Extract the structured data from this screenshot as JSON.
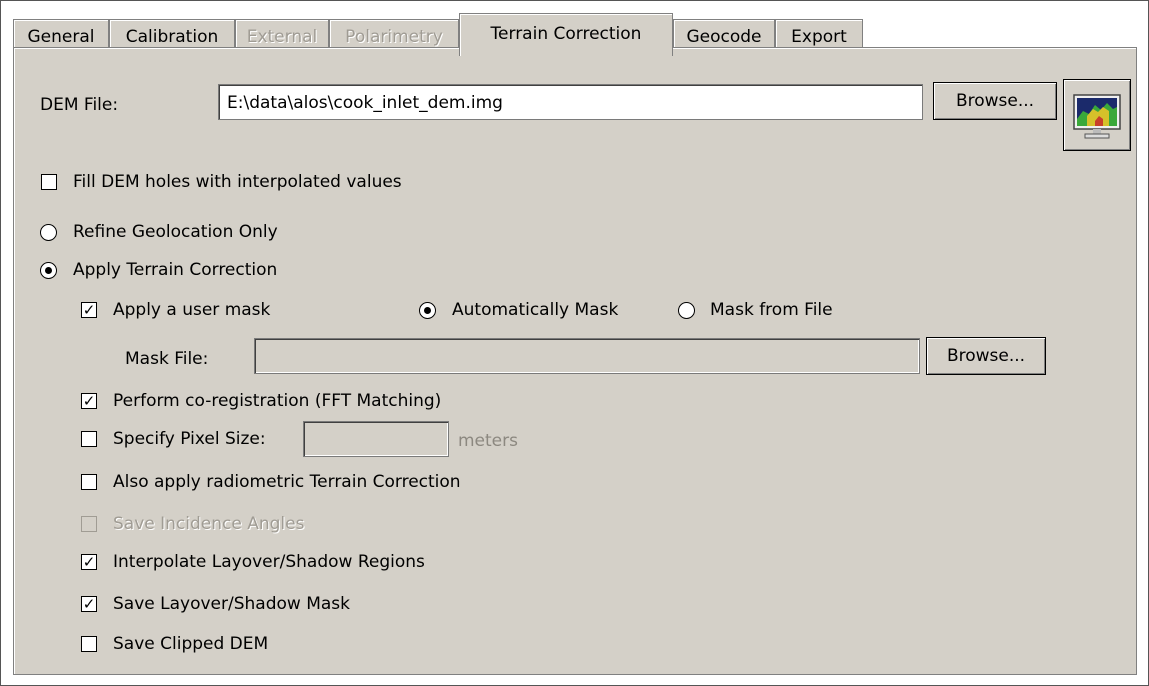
{
  "tabs": [
    {
      "label": "General",
      "enabled": true
    },
    {
      "label": "Calibration",
      "enabled": true
    },
    {
      "label": "External",
      "enabled": false
    },
    {
      "label": "Polarimetry",
      "enabled": false
    },
    {
      "label": "Terrain Correction",
      "enabled": true,
      "active": true
    },
    {
      "label": "Geocode",
      "enabled": true
    },
    {
      "label": "Export",
      "enabled": true
    }
  ],
  "dem": {
    "label": "DEM File:",
    "value": "E:\\data\\alos\\cook_inlet_dem.img",
    "browse_label": "Browse...",
    "view_icon": "dem-preview-monitor-icon"
  },
  "fill_holes": {
    "label": "Fill DEM holes with interpolated values",
    "checked": false
  },
  "mode": {
    "refine_label": "Refine Geolocation Only",
    "apply_label": "Apply Terrain Correction",
    "selected": "apply"
  },
  "mask": {
    "apply_label": "Apply a user mask",
    "apply_checked": true,
    "auto_label": "Automatically Mask",
    "from_file_label": "Mask from File",
    "selected": "auto",
    "file_label": "Mask File:",
    "file_value": "",
    "browse_label": "Browse..."
  },
  "options": {
    "coreg_label": "Perform co-registration (FFT Matching)",
    "coreg_checked": true,
    "pixel_size_label": "Specify Pixel Size:",
    "pixel_size_checked": false,
    "pixel_size_value": "",
    "pixel_size_unit": "meters",
    "radiometric_label": "Also apply radiometric Terrain Correction",
    "radiometric_checked": false,
    "incidence_label": "Save Incidence Angles",
    "incidence_checked": false,
    "incidence_enabled": false,
    "interp_label": "Interpolate Layover/Shadow Regions",
    "interp_checked": true,
    "save_mask_label": "Save Layover/Shadow Mask",
    "save_mask_checked": true,
    "clipped_label": "Save Clipped DEM",
    "clipped_checked": false
  },
  "colors": {
    "panel_bg": "#d4d0c8",
    "disabled_text": "#a09c94"
  }
}
